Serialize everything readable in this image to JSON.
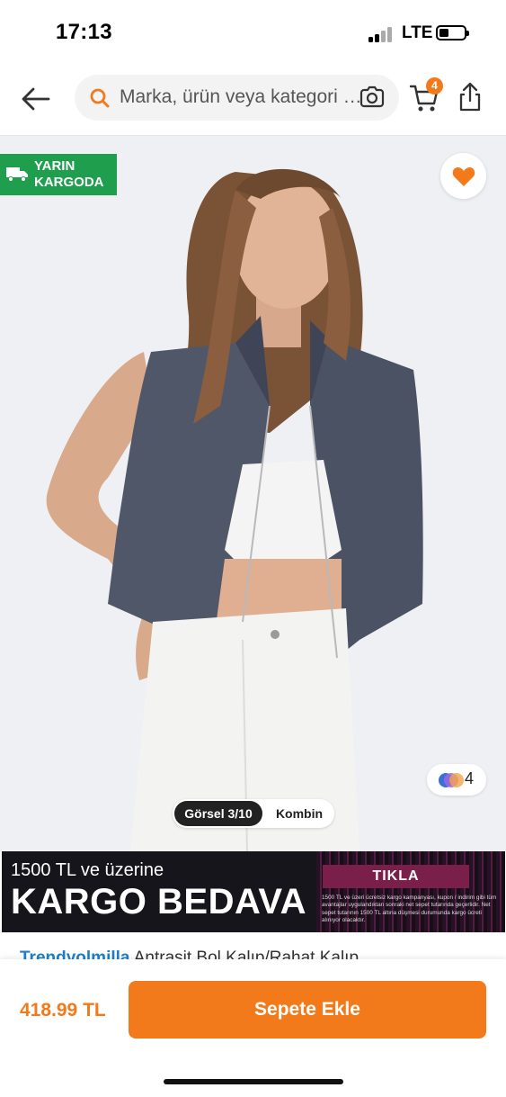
{
  "status_bar": {
    "time": "17:13",
    "network": "LTE"
  },
  "search": {
    "placeholder": "Marka, ürün veya kategori ara"
  },
  "header": {
    "cart_count": "4"
  },
  "product_image": {
    "delivery_badge_line1": "YARIN",
    "delivery_badge_line2": "KARGODA",
    "variant_count": "4",
    "gallery_tab_label": "Görsel 3/10",
    "combo_tab_label": "Kombin"
  },
  "promo_banner": {
    "line1": "1500 TL ve üzerine",
    "line2": "KARGO BEDAVA",
    "cta": "TIKLA",
    "fine_print": "1500 TL ve üzeri ücretsiz kargo kampanyası, kupon / indirim gibi tüm avantajlar uygulandıktan sonraki net sepet tutarında geçerlidir. Net sepet tutarının 1500 TL altına düşmesi durumunda kargo ücreti alınıyor olacaktır."
  },
  "product": {
    "brand": "Trendyolmilla",
    "title": "Antrasit Bol Kalıp/Rahat Kalıp"
  },
  "bottom_bar": {
    "price": "418.99 TL",
    "add_to_cart_label": "Sepete Ekle"
  },
  "colors": {
    "accent": "#f27a1a",
    "delivery_green": "#1f9e4d",
    "brand_link": "#1e7fc8"
  }
}
